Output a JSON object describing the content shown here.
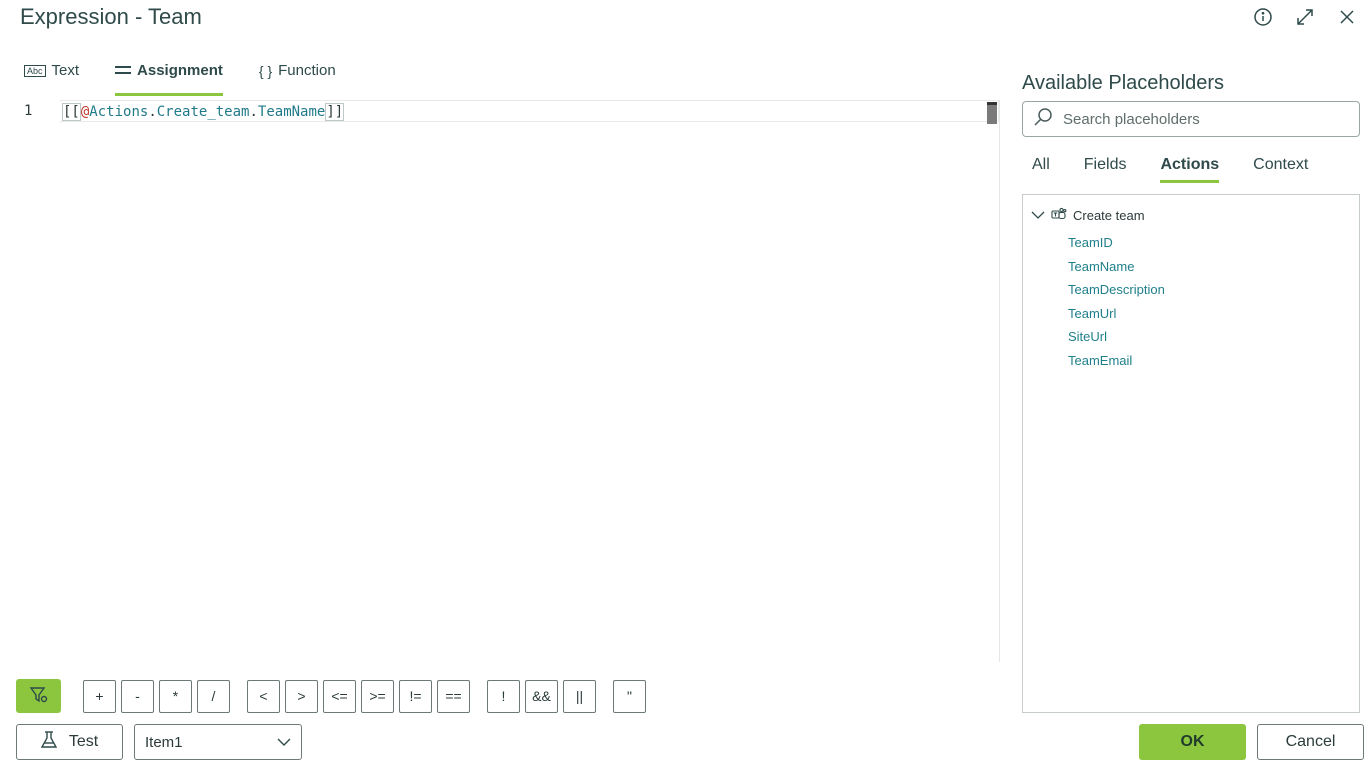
{
  "window": {
    "title": "Expression - Team"
  },
  "tabs": [
    {
      "label": "Text",
      "icon": "text-abc-icon"
    },
    {
      "label": "Assignment",
      "icon": "assignment-icon",
      "active": true
    },
    {
      "label": "Function",
      "icon": "braces-icon"
    }
  ],
  "editor": {
    "line_number": "1",
    "open_brackets": "[[",
    "at": "@",
    "segments": [
      "Actions",
      ".",
      "Create_team",
      ".",
      "TeamName"
    ],
    "close_brackets": "]]"
  },
  "panel": {
    "title": "Available Placeholders",
    "search_placeholder": "Search placeholders",
    "tabs": [
      "All",
      "Fields",
      "Actions",
      "Context"
    ],
    "active_tab": "Actions",
    "tree": {
      "node_label": "Create team",
      "children": [
        "TeamID",
        "TeamName",
        "TeamDescription",
        "TeamUrl",
        "SiteUrl",
        "TeamEmail"
      ]
    }
  },
  "operators": [
    "+",
    "-",
    "*",
    "/",
    "<",
    ">",
    "<=",
    ">=",
    "!=",
    "==",
    "!",
    "&&",
    "||",
    "\""
  ],
  "footer": {
    "test_label": "Test",
    "item_select": "Item1",
    "ok_label": "OK",
    "cancel_label": "Cancel"
  },
  "colors": {
    "accent": "#8cc63f",
    "link": "#1f7f8a"
  }
}
